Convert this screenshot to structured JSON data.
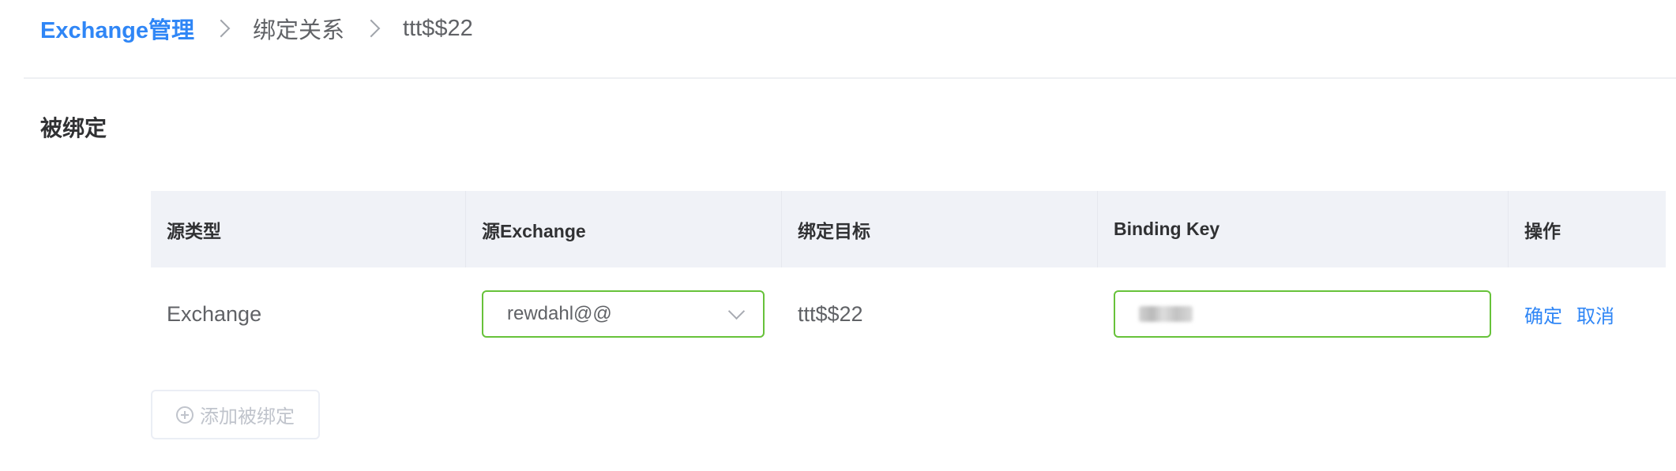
{
  "breadcrumb": {
    "items": [
      {
        "label": "Exchange管理"
      },
      {
        "label": "绑定关系"
      },
      {
        "label": "ttt$$22"
      }
    ]
  },
  "section": {
    "title": "被绑定"
  },
  "table": {
    "headers": [
      "源类型",
      "源Exchange",
      "绑定目标",
      "Binding Key",
      "操作"
    ],
    "row": {
      "source_type": "Exchange",
      "source_exchange": "rewdahl@@",
      "target": "ttt$$22",
      "binding_key": "",
      "actions": {
        "confirm": "确定",
        "cancel": "取消"
      }
    }
  },
  "add_button": {
    "label": "添加被绑定",
    "icon": "plus-circle-icon"
  },
  "colors": {
    "link": "#2f86f6",
    "valid_border": "#67c23a",
    "header_bg": "#f0f2f7",
    "disabled": "#c0c4cc"
  }
}
